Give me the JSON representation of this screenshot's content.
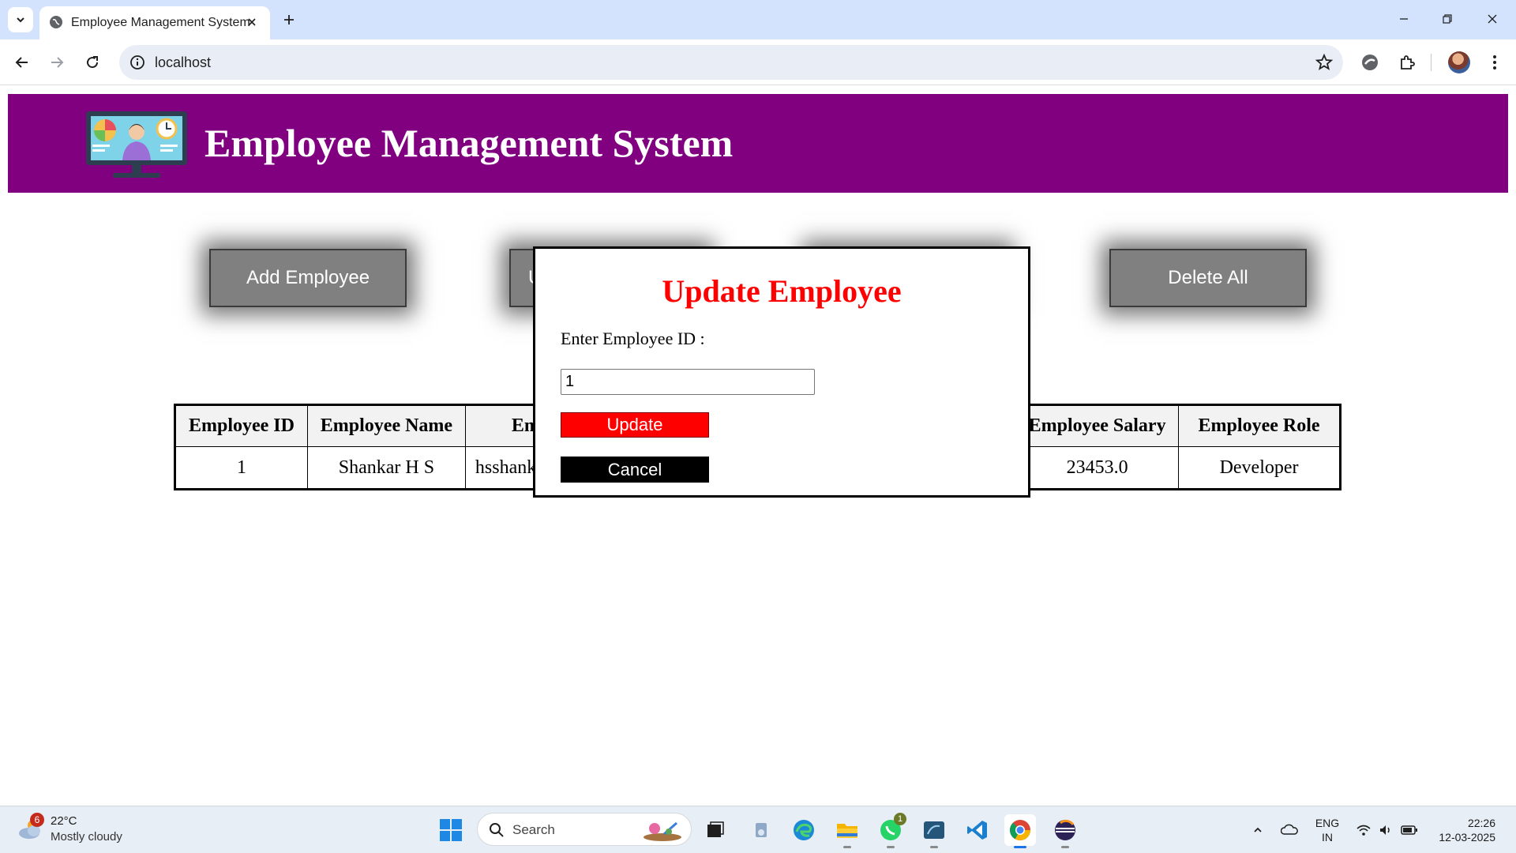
{
  "browser": {
    "tab_title": "Employee Management System",
    "url": "localhost"
  },
  "header": {
    "title": "Employee Management System"
  },
  "actions": {
    "add": "Add Employee",
    "update_partial": "U",
    "delete_all": "Delete All"
  },
  "table": {
    "columns": [
      "Employee ID",
      "Employee Name",
      "Em",
      "Employee Salary",
      "Employee Role"
    ],
    "rows": [
      [
        "1",
        "Shankar H S",
        "hsshank",
        "23453.0",
        "Developer"
      ]
    ]
  },
  "modal": {
    "title": "Update Employee",
    "label": "Enter Employee ID :",
    "input_value": "1",
    "update_label": "Update",
    "cancel_label": "Cancel"
  },
  "colors": {
    "header_bg": "#800080",
    "button_bg": "#808080",
    "modal_title": "#ff0000",
    "update_bg": "#ff0000",
    "cancel_bg": "#000000"
  },
  "taskbar": {
    "weather_badge": "6",
    "temperature": "22°C",
    "weather": "Mostly cloudy",
    "search_label": "Search",
    "whatsapp_badge": "1",
    "lang_line1": "ENG",
    "lang_line2": "IN",
    "time": "22:26",
    "date": "12-03-2025"
  }
}
